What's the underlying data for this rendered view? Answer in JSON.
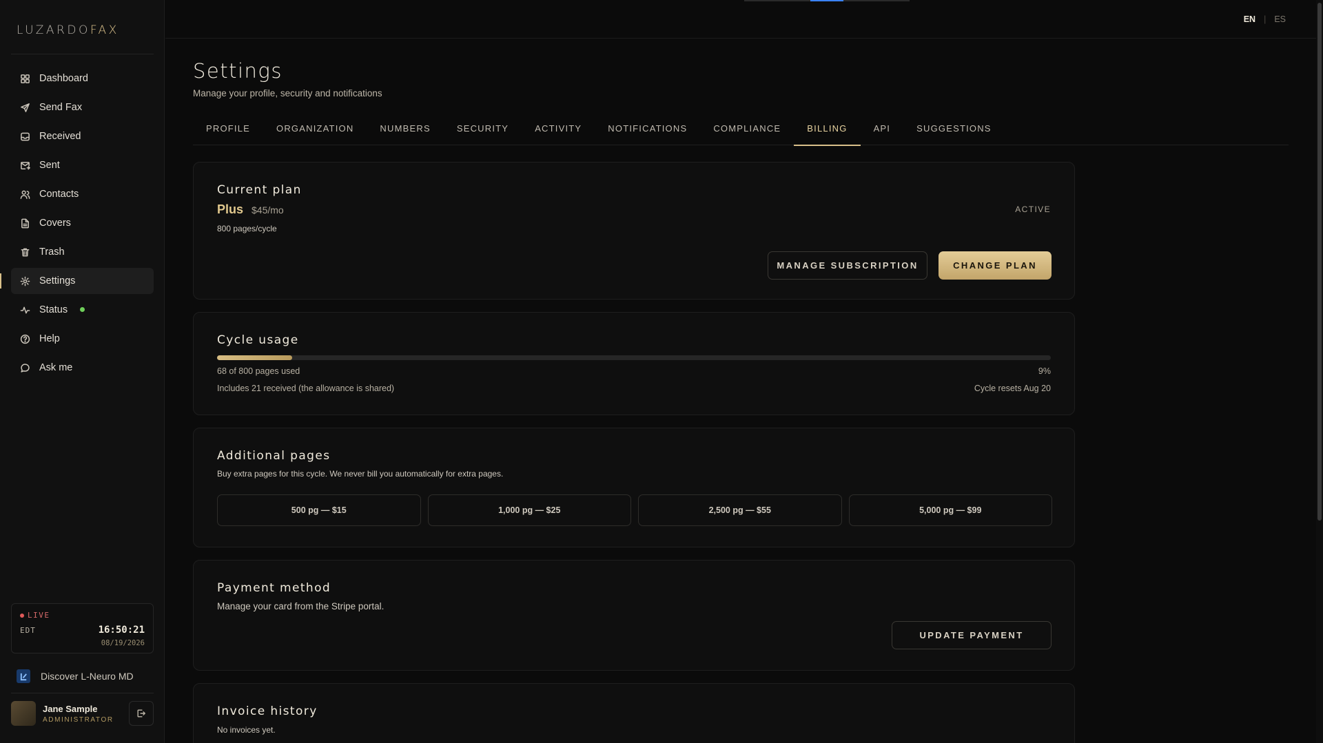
{
  "brand": {
    "name_light": "LUZARDO",
    "name_accent": "FAX"
  },
  "sidebar": {
    "items": [
      {
        "label": "Dashboard",
        "icon": "dashboard-icon"
      },
      {
        "label": "Send Fax",
        "icon": "send-icon"
      },
      {
        "label": "Received",
        "icon": "inbox-icon"
      },
      {
        "label": "Sent",
        "icon": "sent-mail-icon"
      },
      {
        "label": "Contacts",
        "icon": "contacts-icon"
      },
      {
        "label": "Covers",
        "icon": "document-icon"
      },
      {
        "label": "Trash",
        "icon": "trash-icon"
      },
      {
        "label": "Settings",
        "icon": "gear-icon",
        "active": true
      },
      {
        "label": "Status",
        "icon": "activity-icon",
        "status": "online"
      },
      {
        "label": "Help",
        "icon": "help-icon"
      },
      {
        "label": "Ask me",
        "icon": "chat-icon"
      }
    ],
    "clock": {
      "live_label": "LIVE",
      "timezone": "EDT",
      "time": "16:50:21",
      "date": "08/19/2026"
    },
    "discover_label": "Discover L-Neuro MD",
    "user": {
      "name": "Jane Sample",
      "role": "ADMINISTRATOR"
    }
  },
  "topbar": {
    "languages": [
      {
        "code": "EN",
        "active": true
      },
      {
        "code": "ES",
        "active": false
      }
    ],
    "separator": "|"
  },
  "header": {
    "title": "Settings",
    "subtitle": "Manage your profile, security and notifications"
  },
  "tabs": [
    {
      "label": "PROFILE"
    },
    {
      "label": "ORGANIZATION"
    },
    {
      "label": "NUMBERS"
    },
    {
      "label": "SECURITY"
    },
    {
      "label": "ACTIVITY"
    },
    {
      "label": "NOTIFICATIONS"
    },
    {
      "label": "COMPLIANCE"
    },
    {
      "label": "BILLING",
      "active": true
    },
    {
      "label": "API"
    },
    {
      "label": "SUGGESTIONS"
    }
  ],
  "billing": {
    "current_plan": {
      "title": "Current plan",
      "plan_name": "Plus",
      "price": "$45/mo",
      "pages": "800 pages/cycle",
      "status": "ACTIVE",
      "manage_label": "MANAGE SUBSCRIPTION",
      "change_label": "CHANGE PLAN"
    },
    "cycle_usage": {
      "title": "Cycle usage",
      "used_text": "68 of 800 pages used",
      "percent_text": "9%",
      "progress_fraction": 0.09,
      "note": "Includes 21 received (the allowance is shared)",
      "reset": "Cycle resets Aug 20"
    },
    "additional_pages": {
      "title": "Additional pages",
      "description": "Buy extra pages for this cycle. We never bill you automatically for extra pages.",
      "packs": [
        {
          "label": "500 pg — $15"
        },
        {
          "label": "1,000 pg — $25"
        },
        {
          "label": "2,500 pg — $55"
        },
        {
          "label": "5,000 pg — $99"
        }
      ]
    },
    "payment": {
      "title": "Payment method",
      "description": "Manage your card from the Stripe portal.",
      "update_label": "UPDATE PAYMENT"
    },
    "invoices": {
      "title": "Invoice history",
      "empty": "No invoices yet."
    }
  },
  "colors": {
    "accent": "#d9c08a",
    "status_online": "#6fcf5a",
    "live": "#e05a5a",
    "background": "#0b0b0b"
  }
}
